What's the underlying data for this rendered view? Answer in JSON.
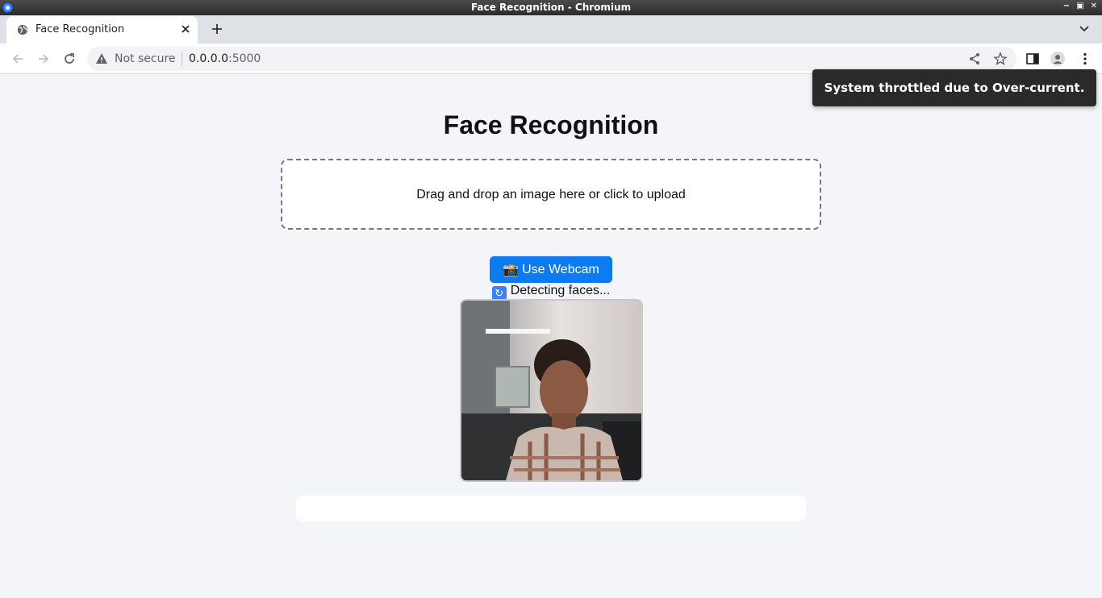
{
  "window": {
    "title": "Face Recognition - Chromium"
  },
  "tab": {
    "title": "Face Recognition"
  },
  "address_bar": {
    "security_label": "Not secure",
    "host": "0.0.0.0",
    "port": ":5000"
  },
  "page": {
    "title": "Face Recognition",
    "dropzone_text": "Drag and drop an image here or click to upload",
    "webcam_button_icon": "📸",
    "webcam_button_label": "Use Webcam",
    "status_text": "Detecting faces..."
  },
  "notification": {
    "text": "System throttled due to Over-current."
  },
  "colors": {
    "primary_button": "#0b7bf2",
    "page_background": "#f4f5f9"
  }
}
